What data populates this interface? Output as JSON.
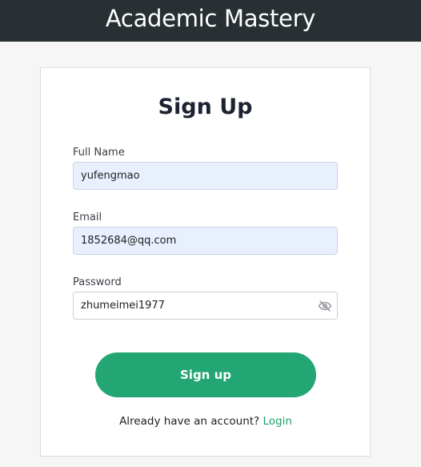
{
  "header": {
    "title": "Academic Mastery",
    "background": "#283033"
  },
  "form": {
    "title": "Sign Up",
    "full_name": {
      "label": "Full Name",
      "value": "yufengmao"
    },
    "email": {
      "label": "Email",
      "value": "1852684@qq.com"
    },
    "password": {
      "label": "Password",
      "value": "zhumeimei1977",
      "toggle_icon": "eye-slash-icon"
    },
    "submit_label": "Sign up",
    "footer": {
      "prompt": "Already have an account?",
      "link_label": "Login"
    }
  },
  "colors": {
    "accent": "#23a673",
    "link": "#22a06b",
    "autofill_bg": "#e8f0fe"
  }
}
